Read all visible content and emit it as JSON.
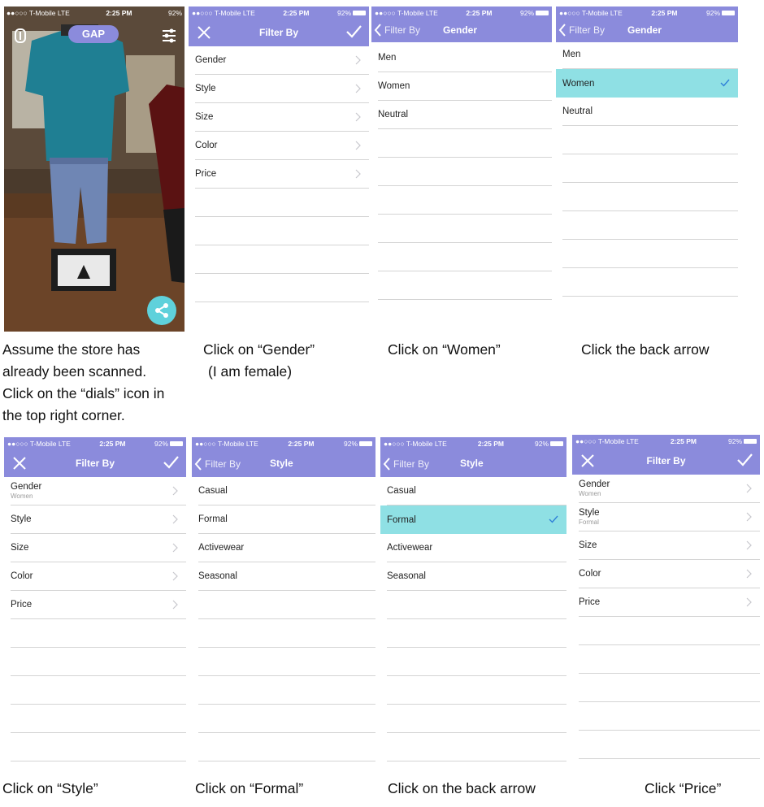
{
  "status": {
    "carrier": "●●○○○ T-Mobile  LTE",
    "time": "2:25 PM",
    "right": "92%"
  },
  "colors": {
    "accent": "#8b8bdc",
    "selected": "#8fe0e4",
    "share": "#5fd1db"
  },
  "camera_screen": {
    "brand_label": "GAP"
  },
  "filter_title": "Filter By",
  "back_label": "Filter By",
  "filter_items": [
    "Gender",
    "Style",
    "Size",
    "Color",
    "Price"
  ],
  "gender_title": "Gender",
  "gender_options": [
    "Men",
    "Women",
    "Neutral"
  ],
  "style_title": "Style",
  "style_options": [
    "Casual",
    "Formal",
    "Activewear",
    "Seasonal"
  ],
  "selected": {
    "gender": "Women",
    "style": "Formal"
  },
  "captions": [
    "Assume the store has",
    "already been scanned.",
    "Click on the “dials” icon in",
    "the top right corner.",
    "Click on “Gender”",
    "(I am female)",
    "Click on “Women”",
    "Click the back arrow",
    "Click on “Style”",
    "Click on “Formal”",
    "Click on the back arrow",
    "Click “Price”"
  ]
}
